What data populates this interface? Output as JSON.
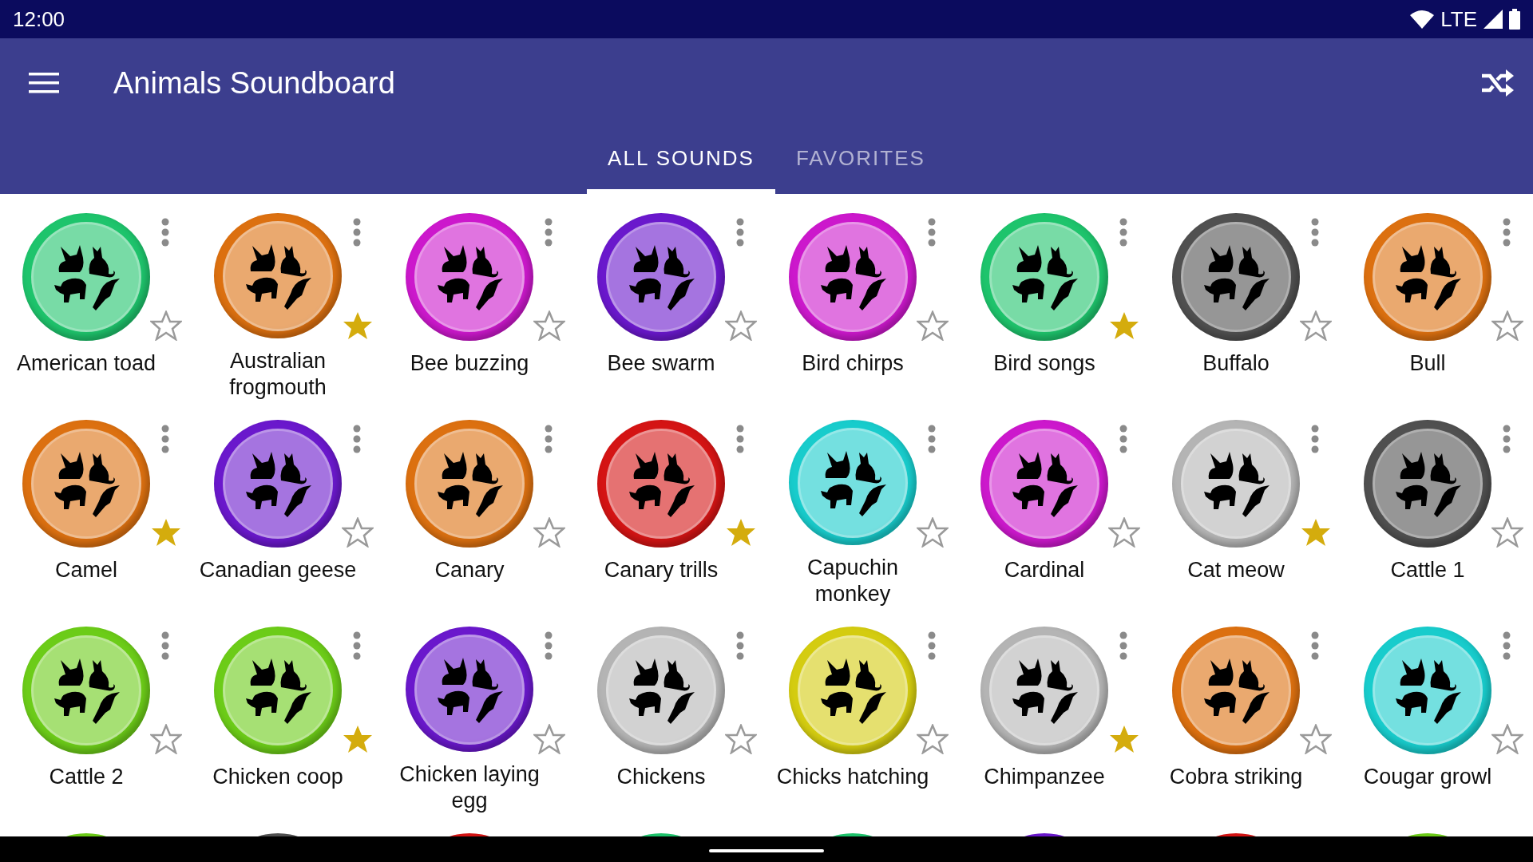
{
  "status_bar": {
    "time": "12:00",
    "network": "LTE"
  },
  "app_bar": {
    "title": "Animals Soundboard"
  },
  "tabs": [
    {
      "label": "ALL SOUNDS",
      "selected": true
    },
    {
      "label": "FAVORITES",
      "selected": false
    }
  ],
  "sounds": [
    {
      "label": "American toad",
      "color": "#1ec46c",
      "favorite": false
    },
    {
      "label": "Australian frogmouth",
      "color": "#dc7010",
      "favorite": true
    },
    {
      "label": "Bee buzzing",
      "color": "#cc18cc",
      "favorite": false
    },
    {
      "label": "Bee swarm",
      "color": "#6a18cc",
      "favorite": false
    },
    {
      "label": "Bird chirps",
      "color": "#cc18cc",
      "favorite": false
    },
    {
      "label": "Bird songs",
      "color": "#1ec46c",
      "favorite": true
    },
    {
      "label": "Buffalo",
      "color": "#505050",
      "favorite": false
    },
    {
      "label": "Bull",
      "color": "#dc7010",
      "favorite": false
    },
    {
      "label": "Camel",
      "color": "#dc7010",
      "favorite": true
    },
    {
      "label": "Canadian geese",
      "color": "#6a18cc",
      "favorite": false
    },
    {
      "label": "Canary",
      "color": "#dc7010",
      "favorite": false
    },
    {
      "label": "Canary trills",
      "color": "#d41414",
      "favorite": true
    },
    {
      "label": "Capuchin monkey",
      "color": "#18cccc",
      "favorite": false
    },
    {
      "label": "Cardinal",
      "color": "#cc18cc",
      "favorite": false
    },
    {
      "label": "Cat meow",
      "color": "#b4b4b4",
      "favorite": true
    },
    {
      "label": "Cattle 1",
      "color": "#505050",
      "favorite": false
    },
    {
      "label": "Cattle 2",
      "color": "#6ccc18",
      "favorite": false
    },
    {
      "label": "Chicken coop",
      "color": "#6ccc18",
      "favorite": true
    },
    {
      "label": "Chicken laying egg",
      "color": "#6a18cc",
      "favorite": false
    },
    {
      "label": "Chickens",
      "color": "#b4b4b4",
      "favorite": false
    },
    {
      "label": "Chicks hatching",
      "color": "#d4cc10",
      "favorite": false
    },
    {
      "label": "Chimpanzee",
      "color": "#b4b4b4",
      "favorite": true
    },
    {
      "label": "Cobra striking",
      "color": "#dc7010",
      "favorite": false
    },
    {
      "label": "Cougar growl",
      "color": "#18cccc",
      "favorite": false
    }
  ],
  "partial_row": [
    {
      "color": "#6ccc18"
    },
    {
      "color": "#505050"
    },
    {
      "color": "#d41414"
    },
    {
      "color": "#1ec46c"
    },
    {
      "color": "#1ec46c"
    },
    {
      "color": "#6a18cc"
    },
    {
      "color": "#d41414"
    },
    {
      "color": "#6ccc18"
    }
  ]
}
